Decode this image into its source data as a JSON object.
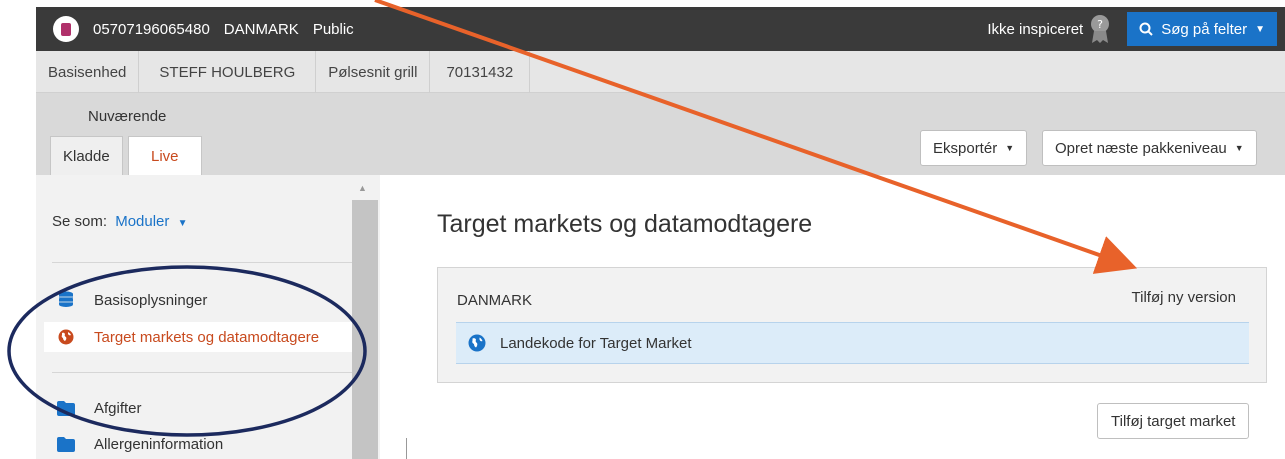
{
  "topbar": {
    "gtin": "05707196065480",
    "country": "DANMARK",
    "visibility": "Public",
    "inspection_status": "Ikke inspiceret",
    "search_label": "Søg på felter"
  },
  "breadcrumbs": [
    "Basisenhed",
    "STEFF HOULBERG",
    "Pølsesnit grill",
    "70131432"
  ],
  "tabs": {
    "group_label": "Nuværende",
    "draft": "Kladde",
    "live": "Live"
  },
  "actions": {
    "export": "Eksportér",
    "next_level": "Opret næste pakkeniveau"
  },
  "sidebar": {
    "view_as_label": "Se som:",
    "view_as_value": "Moduler",
    "items": [
      {
        "label": "Basisoplysninger",
        "icon": "database-icon"
      },
      {
        "label": "Target markets og datamodtagere",
        "icon": "globe-icon",
        "active": true
      },
      {
        "label": "Afgifter",
        "icon": "folder-icon"
      },
      {
        "label": "Allergeninformation",
        "icon": "folder-icon"
      }
    ]
  },
  "main": {
    "title": "Target markets og datamodtagere",
    "panel": {
      "country": "DANMARK",
      "add_version": "Tilføj ny version",
      "row_label": "Landekode for Target Market"
    },
    "add_target_market": "Tilføj target market"
  },
  "colors": {
    "topbar": "#3a3a3a",
    "primary": "#1a73c8",
    "accent": "#c84a1e",
    "annotation_arrow": "#e8622a",
    "annotation_ellipse": "#1c2a5e",
    "row_highlight": "#dcecf9"
  }
}
